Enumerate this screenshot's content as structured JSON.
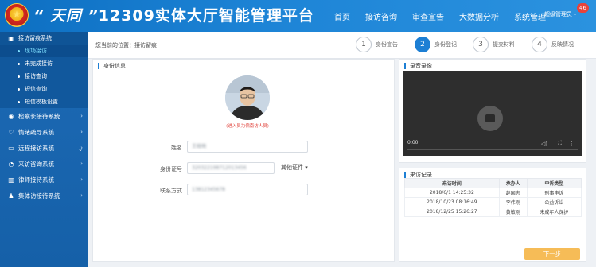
{
  "header": {
    "title_brand": "“ 天同 ”",
    "title_main": "12309实体大厅智能管理平台",
    "nav": [
      "首页",
      "接访咨询",
      "审查宣告",
      "大数据分析",
      "系统管理"
    ],
    "user": "超级管理员",
    "notification_count": "46"
  },
  "sidebar": {
    "group": "接访留痕系统",
    "sub_items": [
      "现场接访",
      "未完成接访",
      "接访查询",
      "短信查询",
      "短信模板设置"
    ],
    "items": [
      "检察长接待系统",
      "情绪疏导系统",
      "远程接访系统",
      "来访咨询系统",
      "律师接待系统",
      "集体访接待系统"
    ]
  },
  "breadcrumb": "您当前的位置：接访留痕",
  "steps": [
    {
      "num": "1",
      "label": "身份宣告"
    },
    {
      "num": "2",
      "label": "身份登记"
    },
    {
      "num": "3",
      "label": "提交材料"
    },
    {
      "num": "4",
      "label": "反映情况"
    }
  ],
  "identity": {
    "title": "身份信息",
    "avatar_note": "(进入员为偏南访人员)",
    "name_label": "姓名",
    "name_value": "王晓明",
    "id_label": "身份证号",
    "id_value": "320322198712013456",
    "id_type": "其他证件",
    "phone_label": "联系方式",
    "phone_value": "13812345678"
  },
  "recording": {
    "title": "录音录像",
    "time": "0:00"
  },
  "visits": {
    "title": "来访记录",
    "headers": [
      "来访时间",
      "承办人",
      "申诉类型"
    ],
    "rows": [
      [
        "2018/6/1 14:25:32",
        "赵国忠",
        "刑事申诉"
      ],
      [
        "2018/10/23 08:16:49",
        "李伟刚",
        "公益诉讼"
      ],
      [
        "2018/12/25 15:26:27",
        "黄敏刚",
        "未成年人保护"
      ]
    ]
  },
  "next_button": "下一步",
  "colors": {
    "header_blue": "#1d84d6",
    "sidebar_blue": "#1560a8",
    "active_step": "#1d7fd4",
    "next_button": "#f6bc57",
    "badge": "#e9423a"
  }
}
